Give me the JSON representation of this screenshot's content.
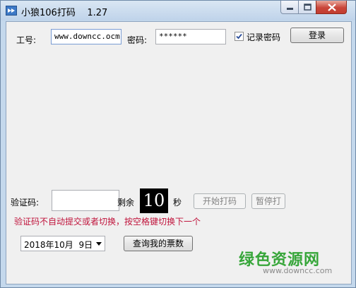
{
  "window": {
    "title": "小狼106打码    1.27"
  },
  "login": {
    "id_label": "工号:",
    "id_value": "www.downcc.ocm",
    "password_label": "密码:",
    "password_value": "******",
    "remember_label": "记录密码",
    "remember_checked": true,
    "login_button": "登录"
  },
  "captcha": {
    "label": "验证码:",
    "input_value": "",
    "remaining_label": "剩余",
    "countdown": "10",
    "seconds_label": "秒",
    "start_button": "开始打码",
    "pause_button": "暂停打",
    "warning": "验证码不自动提交或者切换，按空格键切换下一个"
  },
  "query": {
    "date_value": "2018年10月  9日",
    "query_button": "查询我的票数"
  },
  "watermark": {
    "logo_text": "绿色资源网",
    "url": "www.downcc.com"
  },
  "colors": {
    "title_bar": "#c4d8ec",
    "client_bg": "#f0f0f0",
    "warning_text": "#c0143c",
    "counter_bg": "#000000",
    "watermark_green": "#37a63a"
  }
}
